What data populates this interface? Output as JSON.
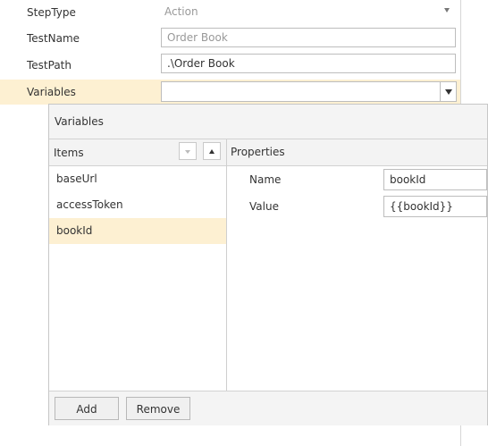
{
  "property_grid": {
    "rows": [
      {
        "label": "StepType",
        "value": "Action"
      },
      {
        "label": "TestName",
        "value": "Order Book"
      },
      {
        "label": "TestPath",
        "value": ".\\Order Book"
      },
      {
        "label": "Variables",
        "value": ""
      }
    ]
  },
  "variables_popup": {
    "title": "Variables",
    "items_header": "Items",
    "properties_header": "Properties",
    "items": [
      {
        "label": "baseUrl"
      },
      {
        "label": "accessToken"
      },
      {
        "label": "bookId"
      }
    ],
    "selected_item": "bookId",
    "properties": [
      {
        "label": "Name",
        "value": "bookId"
      },
      {
        "label": "Value",
        "value": "{{bookId}}"
      }
    ],
    "buttons": {
      "add": "Add",
      "remove": "Remove"
    }
  },
  "colors": {
    "selection_bg": "#fdf0d2",
    "border": "#bdbdbd"
  },
  "icons": [
    "chevron-down-icon",
    "chevron-up-icon",
    "dropdown-arrow-icon"
  ]
}
